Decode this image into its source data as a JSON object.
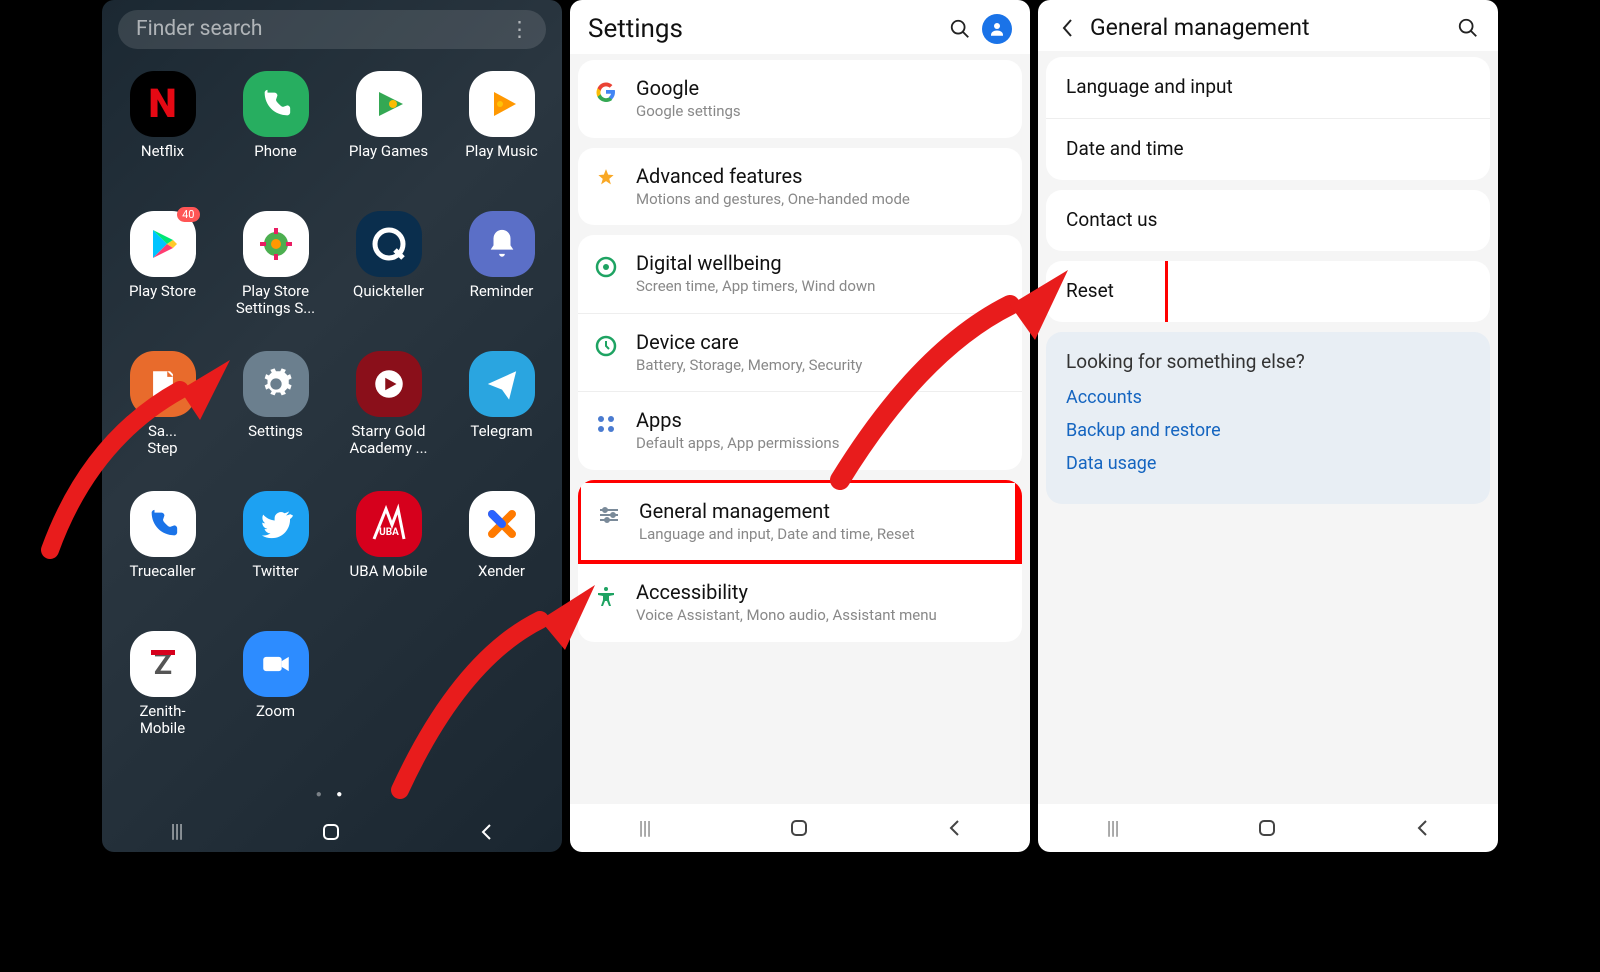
{
  "screen1": {
    "finder_placeholder": "Finder search",
    "apps": [
      {
        "label": "Netflix",
        "name": "netflix-icon",
        "bg": "#000",
        "letter": "N",
        "lc": "#e50914"
      },
      {
        "label": "Phone",
        "name": "phone-icon",
        "bg": "#27ae60",
        "glyph": "phone"
      },
      {
        "label": "Play Games",
        "name": "play-games-icon",
        "bg": "#fff",
        "glyph": "playgames"
      },
      {
        "label": "Play Music",
        "name": "play-music-icon",
        "bg": "#fff",
        "glyph": "playmusic"
      },
      {
        "label": "Play Store",
        "name": "play-store-icon",
        "bg": "#fff",
        "glyph": "playstore",
        "badge": "40"
      },
      {
        "label": "Play Store Settings S...",
        "name": "play-store-settings-icon",
        "bg": "#fff",
        "glyph": "gearcolor"
      },
      {
        "label": "Quickteller",
        "name": "quickteller-icon",
        "bg": "#0a2e4d",
        "glyph": "q"
      },
      {
        "label": "Reminder",
        "name": "reminder-icon",
        "bg": "#5b6fc7",
        "glyph": "bell"
      },
      {
        "label": "Sa...\nStep",
        "name": "samsung-step-icon",
        "bg": "#e86b2c",
        "glyph": "note"
      },
      {
        "label": "Settings",
        "name": "settings-icon",
        "bg": "#6b7f8e",
        "glyph": "gear",
        "hot": true
      },
      {
        "label": "Starry Gold Academy ...",
        "name": "starry-gold-icon",
        "bg": "#8a0f1a",
        "glyph": "play"
      },
      {
        "label": "Telegram",
        "name": "telegram-icon",
        "bg": "#2aa5e0",
        "glyph": "send"
      },
      {
        "label": "Truecaller",
        "name": "truecaller-icon",
        "bg": "#fff",
        "glyph": "phone2"
      },
      {
        "label": "Twitter",
        "name": "twitter-icon",
        "bg": "#1da1f2",
        "glyph": "twitter"
      },
      {
        "label": "UBA Mobile",
        "name": "uba-icon",
        "bg": "#d6001c",
        "glyph": "uba"
      },
      {
        "label": "Xender",
        "name": "xender-icon",
        "bg": "#fff",
        "glyph": "xender"
      },
      {
        "label": "Zenith-\nMobile",
        "name": "zenith-icon",
        "bg": "#fff",
        "glyph": "zenith"
      },
      {
        "label": "Zoom",
        "name": "zoom-icon",
        "bg": "#2d8cff",
        "glyph": "cam"
      }
    ]
  },
  "screen2": {
    "title": "Settings",
    "groups": [
      [
        {
          "title": "Google",
          "sub": "Google settings",
          "icon": "google",
          "name": "google-row"
        }
      ],
      [
        {
          "title": "Advanced features",
          "sub": "Motions and gestures, One-handed mode",
          "icon": "star-gear",
          "name": "advanced-features-row"
        }
      ],
      [
        {
          "title": "Digital wellbeing",
          "sub": "Screen time, App timers, Wind down",
          "icon": "wellbeing",
          "name": "digital-wellbeing-row"
        },
        {
          "title": "Device care",
          "sub": "Battery, Storage, Memory, Security",
          "icon": "devicecare",
          "name": "device-care-row"
        },
        {
          "title": "Apps",
          "sub": "Default apps, App permissions",
          "icon": "apps",
          "name": "apps-row"
        }
      ],
      [
        {
          "title": "General management",
          "sub": "Language and input, Date and time, Reset",
          "icon": "sliders",
          "name": "general-management-row",
          "hot": true
        },
        {
          "title": "Accessibility",
          "sub": "Voice Assistant, Mono audio, Assistant menu",
          "icon": "a11y",
          "name": "accessibility-row"
        }
      ]
    ]
  },
  "screen3": {
    "title": "General management",
    "rows1": [
      {
        "title": "Language and input",
        "name": "language-input-row"
      },
      {
        "title": "Date and time",
        "name": "date-time-row"
      }
    ],
    "rows2": [
      {
        "title": "Contact us",
        "name": "contact-us-row"
      }
    ],
    "rows3": [
      {
        "title": "Reset",
        "name": "reset-row",
        "hot": true
      }
    ],
    "info_head": "Looking for something else?",
    "info_links": [
      "Accounts",
      "Backup and restore",
      "Data usage"
    ]
  }
}
